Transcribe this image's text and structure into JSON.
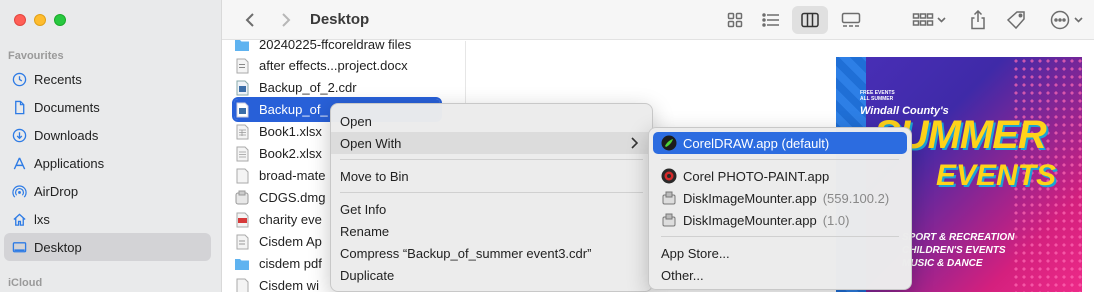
{
  "sidebar": {
    "favourites_label": "Favourites",
    "icloud_label": "iCloud",
    "items": [
      {
        "label": "Recents"
      },
      {
        "label": "Documents"
      },
      {
        "label": "Downloads"
      },
      {
        "label": "Applications"
      },
      {
        "label": "AirDrop"
      },
      {
        "label": "lxs"
      },
      {
        "label": "Desktop"
      }
    ]
  },
  "toolbar": {
    "title": "Desktop",
    "icons": [
      "back-icon",
      "forward-icon",
      "icon-view-icon",
      "list-view-icon",
      "column-view-icon",
      "gallery-view-icon",
      "group-icon",
      "share-icon",
      "tag-icon",
      "more-icon"
    ]
  },
  "files": [
    {
      "name": "20240225-ffcoreldraw files"
    },
    {
      "name": "after effects...project.docx"
    },
    {
      "name": "Backup_of_2.cdr"
    },
    {
      "name": "Backup_of_"
    },
    {
      "name": "Book1.xlsx"
    },
    {
      "name": "Book2.xlsx"
    },
    {
      "name": "broad-mate"
    },
    {
      "name": "CDGS.dmg"
    },
    {
      "name": "charity eve"
    },
    {
      "name": "Cisdem Ap"
    },
    {
      "name": "cisdem pdf"
    },
    {
      "name": "Cisdem wi"
    }
  ],
  "context_menu": {
    "open": "Open",
    "open_with": "Open With",
    "move_to_bin": "Move to Bin",
    "get_info": "Get Info",
    "rename": "Rename",
    "compress": "Compress “Backup_of_summer event3.cdr”",
    "duplicate": "Duplicate"
  },
  "submenu": {
    "items": [
      {
        "label": "CorelDRAW.app (default)",
        "version": ""
      },
      {
        "label": "Corel PHOTO-PAINT.app",
        "version": ""
      },
      {
        "label": "DiskImageMounter.app",
        "version": "(559.100.2)"
      },
      {
        "label": "DiskImageMounter.app",
        "version": "(1.0)"
      }
    ],
    "app_store": "App Store...",
    "other": "Other..."
  },
  "poster": {
    "free_events": "FREE EVENTS",
    "all_summer": "ALL SUMMER",
    "county": "Windall County's",
    "big": "SUMMER",
    "events": "EVENTS",
    "tags": [
      "SPORT & RECREATION",
      "CHILDREN'S EVENTS",
      "MUSIC & DANCE"
    ]
  }
}
